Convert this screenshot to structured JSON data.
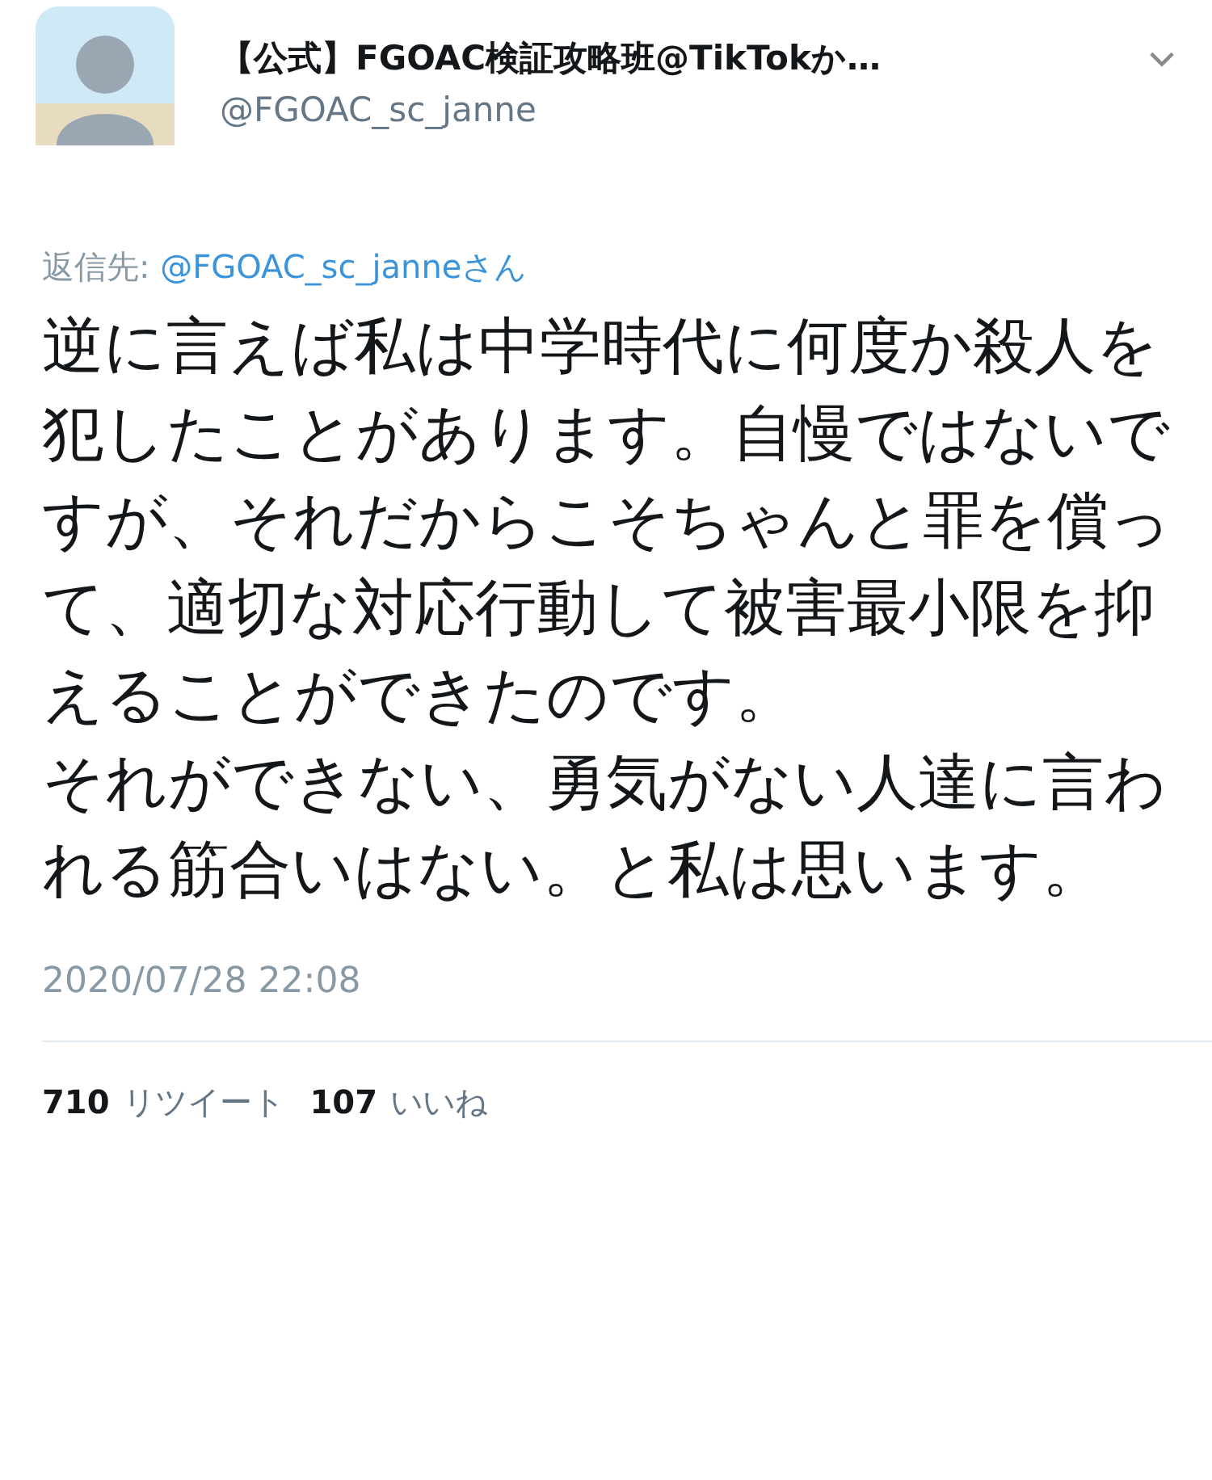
{
  "author": {
    "name": "【公式】FGOAC検証攻略班@TikTokか…",
    "handle": "@FGOAC_sc_janne"
  },
  "reply_to": {
    "label": "返信先: ",
    "handle": "@FGOAC_sc_janneさん"
  },
  "body": [
    "逆に言えば私は中学時代に何度か殺人を犯したことがあります。自慢ではないですが、それだからこそちゃんと罪を償って、適切な対応行動して被害最小限を抑えることができたのです。",
    "それができない、勇気がない人達に言われる筋合いはない。と私は思います。"
  ],
  "timestamp": "2020/07/28 22:08",
  "stats": [
    {
      "count": "710",
      "label": "リツイート"
    },
    {
      "count": "107",
      "label": "いいね"
    }
  ]
}
